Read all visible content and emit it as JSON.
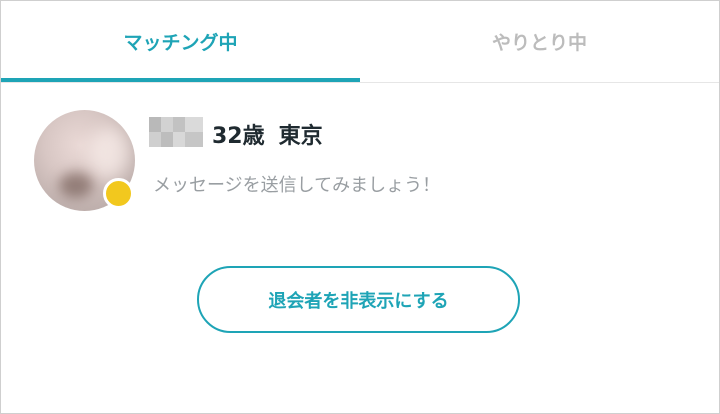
{
  "tabs": {
    "matching_label": "マッチング中",
    "chatting_label": "やりとり中",
    "active_index": 0
  },
  "match": {
    "age": "32歳",
    "location": "東京",
    "prompt": "メッセージを送信してみましょう！",
    "status": "online"
  },
  "actions": {
    "hide_withdrawn_label": "退会者を非表示にする"
  },
  "colors": {
    "accent": "#1ea4b6",
    "inactive_tab": "#bcbcbc",
    "online_dot": "#f2c81e",
    "prompt_text": "#999ea2",
    "name_text": "#1f2a30"
  }
}
